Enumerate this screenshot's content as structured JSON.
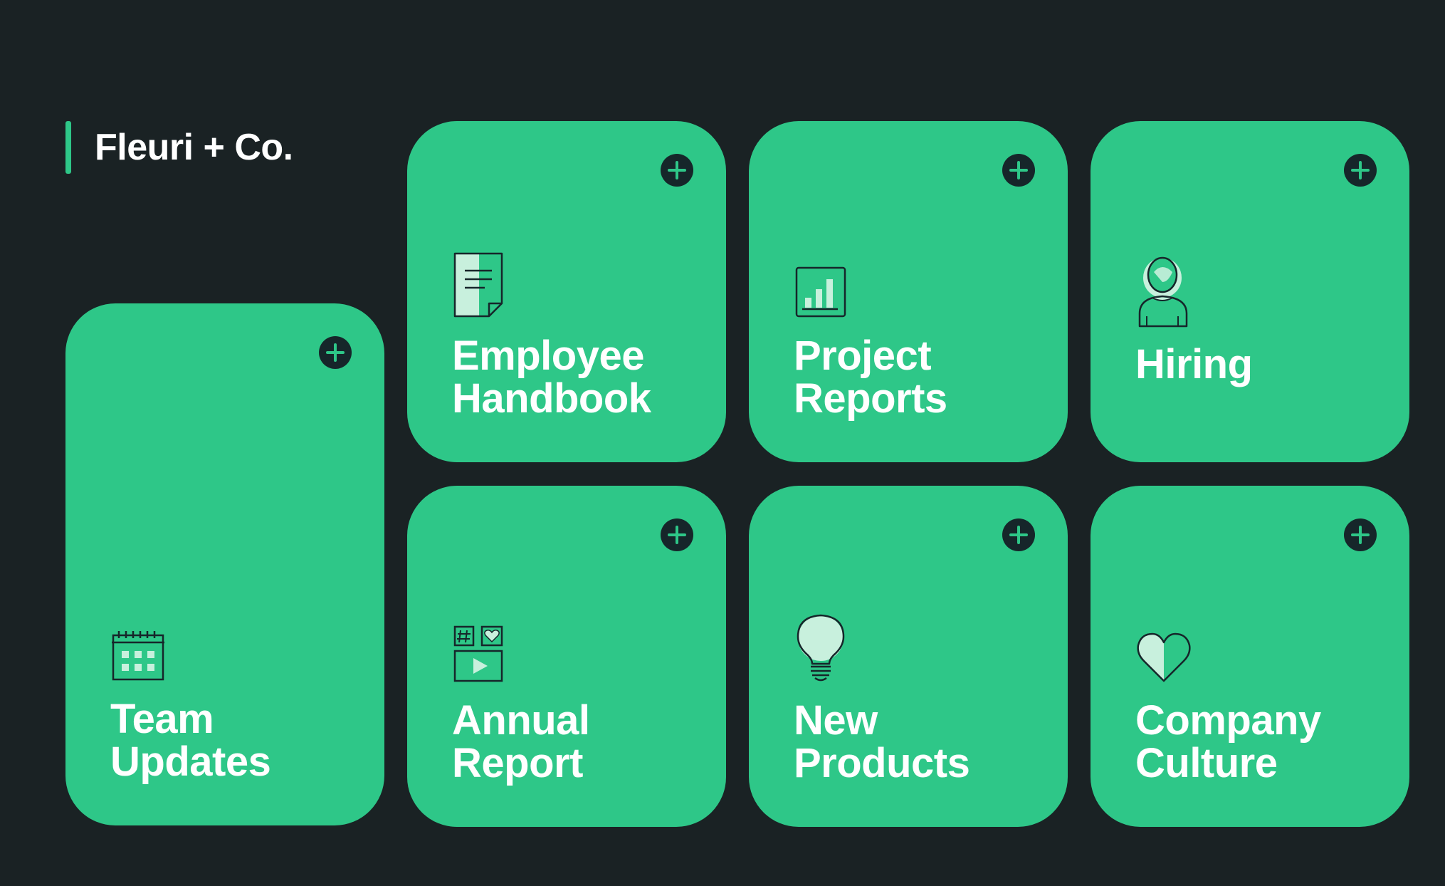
{
  "brand": {
    "name": "Fleuri + Co."
  },
  "tiles": [
    {
      "label": "Team Updates",
      "icon": "calendar-icon"
    },
    {
      "label": "Employee Handbook",
      "icon": "document-icon"
    },
    {
      "label": "Project Reports",
      "icon": "bar-chart-icon"
    },
    {
      "label": "Hiring",
      "icon": "person-icon"
    },
    {
      "label": "Annual Report",
      "icon": "media-grid-icon"
    },
    {
      "label": "New Products",
      "icon": "lightbulb-icon"
    },
    {
      "label": "Company Culture",
      "icon": "heart-icon"
    }
  ],
  "colors": {
    "background": "#1a2224",
    "tile": "#2ec788",
    "accent_dark": "#16262a",
    "icon_fill": "#c8f0dd"
  }
}
